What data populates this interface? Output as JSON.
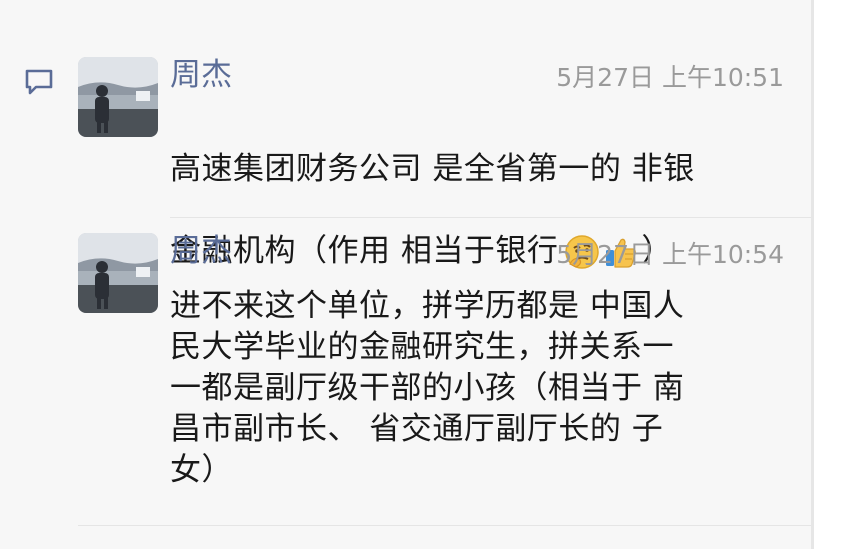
{
  "comments": [
    {
      "name": "周杰",
      "time": "5月27日 上午10:51",
      "content_line1": "高速集团财务公司 是全省第一的 非银",
      "content_line2_prefix": "金融机构（作用 相当于银行",
      "content_line2_suffix": "）",
      "emojis": [
        "thinking-face-icon",
        "thumbs-up-icon"
      ]
    },
    {
      "name": "周杰",
      "time": "5月27日 上午10:54",
      "content": "进不来这个单位，拼学历都是 中国人\n民大学毕业的金融研究生，拼关系一\n一都是副厅级干部的小孩（相当于 南\n昌市副市长、 省交通厅副厅长的 子\n女）"
    }
  ],
  "colors": {
    "name": "#5a6c97",
    "time": "#9a9a9a",
    "text": "#191919",
    "panel_bg": "#f7f7f7",
    "separator": "#e5e5e5"
  },
  "icons": {
    "comment_icon": "comment-icon"
  }
}
